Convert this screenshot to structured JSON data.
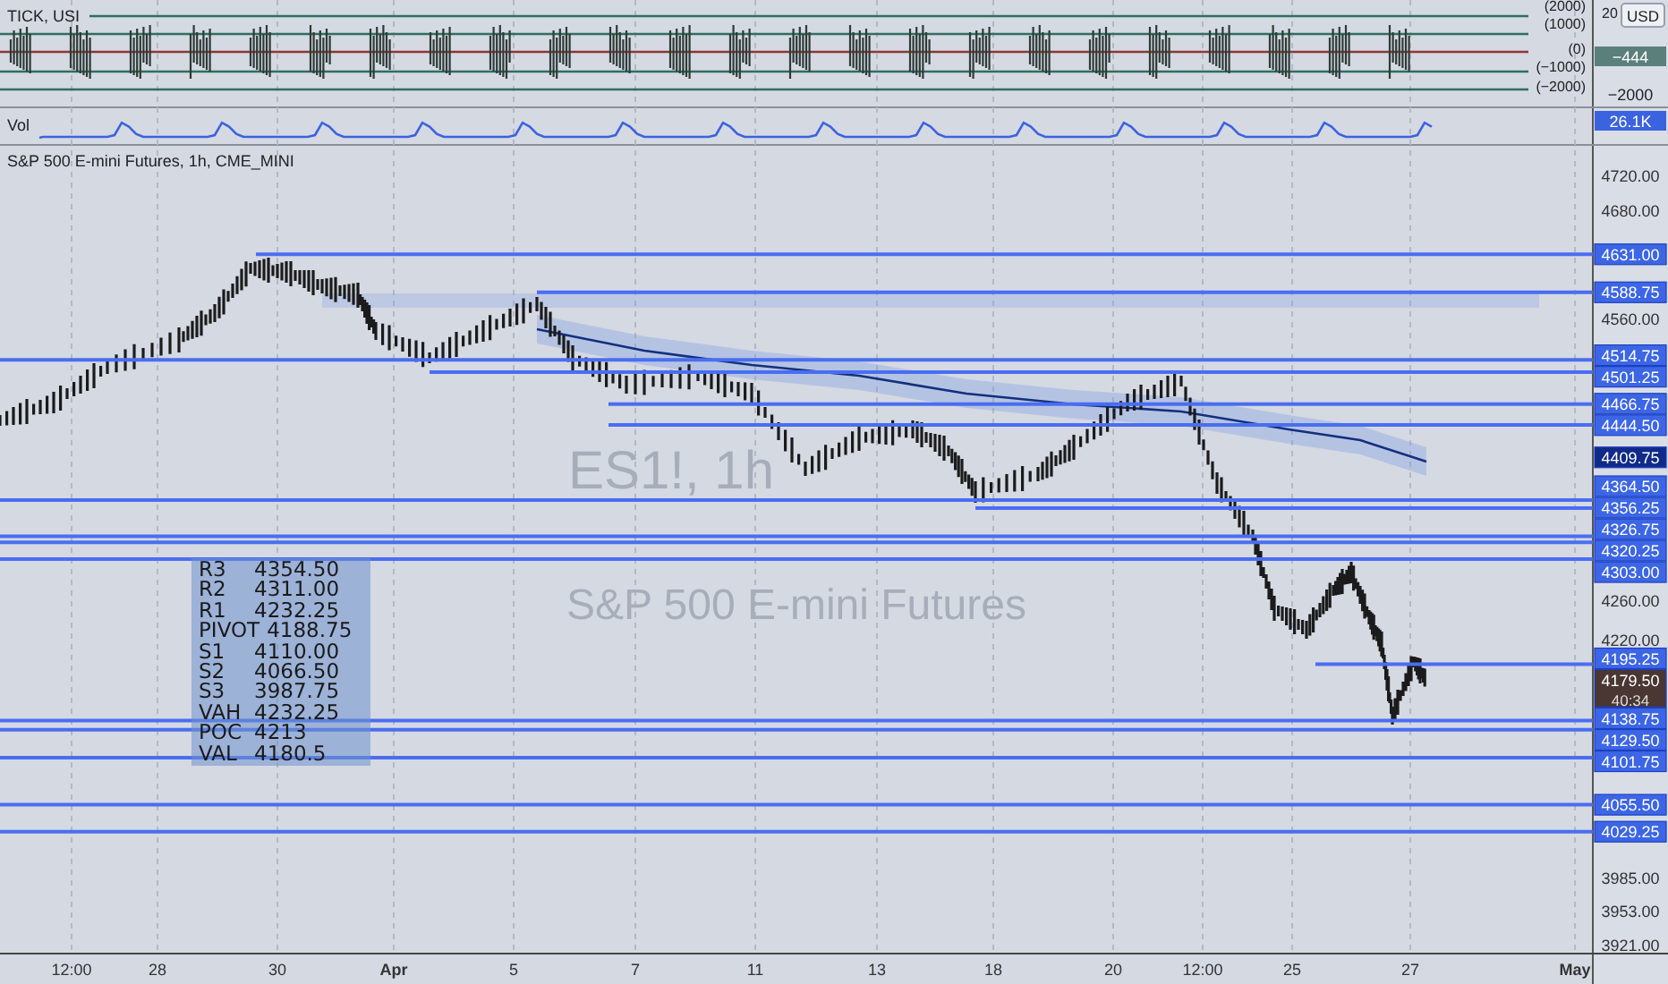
{
  "tick_panel": {
    "title": "TICK, USI",
    "scale_labels": [
      "(2000)",
      "(1000)",
      "(0)",
      "(−1000)",
      "(−2000)"
    ],
    "axis_labels": [
      "20",
      "−2000"
    ],
    "currency_button": "USD",
    "value_tag": "−444"
  },
  "volume_panel": {
    "title": "Vol",
    "value_tag": "26.1K"
  },
  "main_chart": {
    "title": "S&P 500 E-mini Futures, 1h, CME_MINI",
    "watermark_symbol": "ES1!, 1h",
    "watermark_name": "S&P 500 E-mini Futures",
    "price_axis": [
      "4720.00",
      "4680.00",
      "4560.00",
      "4260.00",
      "4220.00",
      "3985.00",
      "3953.00",
      "3921.00"
    ],
    "levels": [
      {
        "kind": "level",
        "label": "4631.00"
      },
      {
        "kind": "level",
        "label": "4588.75"
      },
      {
        "kind": "level",
        "label": "4514.75"
      },
      {
        "kind": "level",
        "label": "4501.25"
      },
      {
        "kind": "level",
        "label": "4466.75"
      },
      {
        "kind": "level",
        "label": "4444.50"
      },
      {
        "kind": "average",
        "label": "4409.75"
      },
      {
        "kind": "level",
        "label": "4364.50"
      },
      {
        "kind": "level",
        "label": "4356.25"
      },
      {
        "kind": "level",
        "label": "4326.75"
      },
      {
        "kind": "level",
        "label": "4320.25"
      },
      {
        "kind": "level",
        "label": "4303.00"
      },
      {
        "kind": "level",
        "label": "4195.25"
      },
      {
        "kind": "last",
        "label": "4179.50",
        "countdown": "40:34"
      },
      {
        "kind": "level",
        "label": "4138.75"
      },
      {
        "kind": "level",
        "label": "4129.50"
      },
      {
        "kind": "level",
        "label": "4101.75"
      },
      {
        "kind": "level",
        "label": "4055.50"
      },
      {
        "kind": "level",
        "label": "4029.25"
      }
    ],
    "pivot_table": [
      {
        "label": "R3",
        "value": "4354.50"
      },
      {
        "label": "R2",
        "value": "4311.00"
      },
      {
        "label": "R1",
        "value": "4232.25"
      },
      {
        "label": "PIVOT",
        "value": "4188.75"
      },
      {
        "label": "S1",
        "value": "4110.00"
      },
      {
        "label": "S2",
        "value": "4066.50"
      },
      {
        "label": "S3",
        "value": "3987.75"
      },
      {
        "label": "VAH",
        "value": "4232.25"
      },
      {
        "label": "POC",
        "value": "4213"
      },
      {
        "label": "VAL",
        "value": "4180.5"
      }
    ]
  },
  "time_axis": [
    {
      "label": "12:00",
      "bold": false
    },
    {
      "label": "28",
      "bold": false
    },
    {
      "label": "30",
      "bold": false
    },
    {
      "label": "Apr",
      "bold": true
    },
    {
      "label": "5",
      "bold": false
    },
    {
      "label": "7",
      "bold": false
    },
    {
      "label": "11",
      "bold": false
    },
    {
      "label": "13",
      "bold": false
    },
    {
      "label": "18",
      "bold": false
    },
    {
      "label": "20",
      "bold": false
    },
    {
      "label": "12:00",
      "bold": false
    },
    {
      "label": "25",
      "bold": false
    },
    {
      "label": "27",
      "bold": false
    },
    {
      "label": "May",
      "bold": true
    }
  ]
}
